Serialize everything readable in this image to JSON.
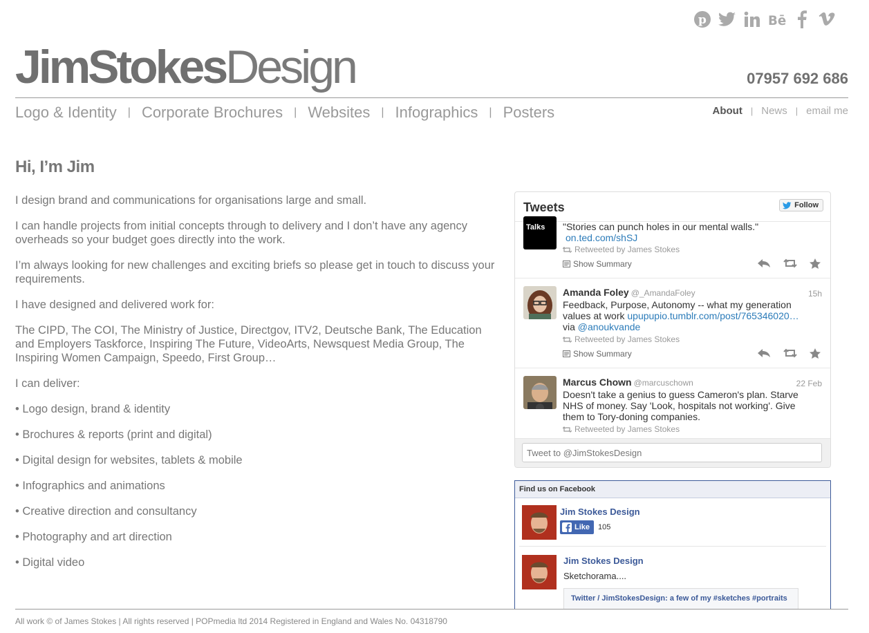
{
  "social": {
    "icons": [
      "pinterest-icon",
      "twitter-icon",
      "linkedin-icon",
      "behance-icon",
      "facebook-icon",
      "vimeo-icon"
    ]
  },
  "header": {
    "logo_bold": "JimStokes",
    "logo_light": "Design",
    "phone": "07957 692 686"
  },
  "nav": {
    "main": [
      "Logo & Identity",
      "Corporate Brochures",
      "Websites",
      "Infographics",
      "Posters"
    ],
    "separator": "|",
    "sub": [
      "About",
      "News",
      "email me"
    ]
  },
  "main": {
    "heading": "Hi, I’m Jim",
    "paragraphs": [
      "I design brand and communications for organisations large and small.",
      "I can handle projects from initial concepts through to delivery and I don’t have any agency overheads so your budget goes directly into the work.",
      "I’m always looking for new challenges and exciting briefs so please get in touch to discuss your requirements.",
      "I have designed and delivered work for:",
      "The CIPD, The COI, The Ministry of Justice, Directgov, ITV2, Deutsche Bank, The Education and Employers Taskforce, Inspiring The Future, VideoArts, Newsquest Media Group, The Inspiring Women Campaign, Speedo, First Group…",
      "I can deliver:",
      "• Logo design, brand & identity",
      "• Brochures & reports (print and digital)",
      "• Digital design for websites, tablets & mobile",
      "• Infographics and animations",
      "• Creative direction and consultancy",
      "• Photography and art direction",
      "• Digital video"
    ]
  },
  "twitter": {
    "title": "Tweets",
    "follow": "Follow",
    "t0": {
      "avatar_text": "Talks",
      "text": "\"Stories can punch holes in our mental walls.\"",
      "link": "on.ted.com/shSJ",
      "retweeted": "Retweeted by James Stokes",
      "summary": "Show Summary"
    },
    "t1": {
      "name": "Amanda Foley",
      "handle": "@_AmandaFoley",
      "time": "15h",
      "text": "Feedback, Purpose, Autonomy -- what my generation values at work",
      "link": "upupupio.tumblr.com/post/765346020…",
      "via": "via",
      "via_link": "@anoukvande",
      "retweeted": "Retweeted by James Stokes",
      "summary": "Show Summary"
    },
    "t2": {
      "name": "Marcus Chown",
      "handle": "@marcuschown",
      "time": "22 Feb",
      "text": "Doesn't take a genius to guess Cameron's plan. Starve NHS of money. Say 'Look, hospitals not working'. Give them to Tory-doning companies.",
      "retweeted": "Retweeted by James Stokes"
    },
    "compose_placeholder": "Tweet to @JimStokesDesign"
  },
  "facebook": {
    "title": "Find us on Facebook",
    "page_name": "Jim Stokes Design",
    "like": "Like",
    "like_count": "105",
    "post_author": "Jim Stokes Design",
    "post_text": "Sketchorama....",
    "post_link": "Twitter / JimStokesDesign: a few of my #sketches #portraits"
  },
  "footer": "All work © of James Stokes | All rights reserved | POPmedia ltd 2014 Registered in England and Wales No. 04318790"
}
